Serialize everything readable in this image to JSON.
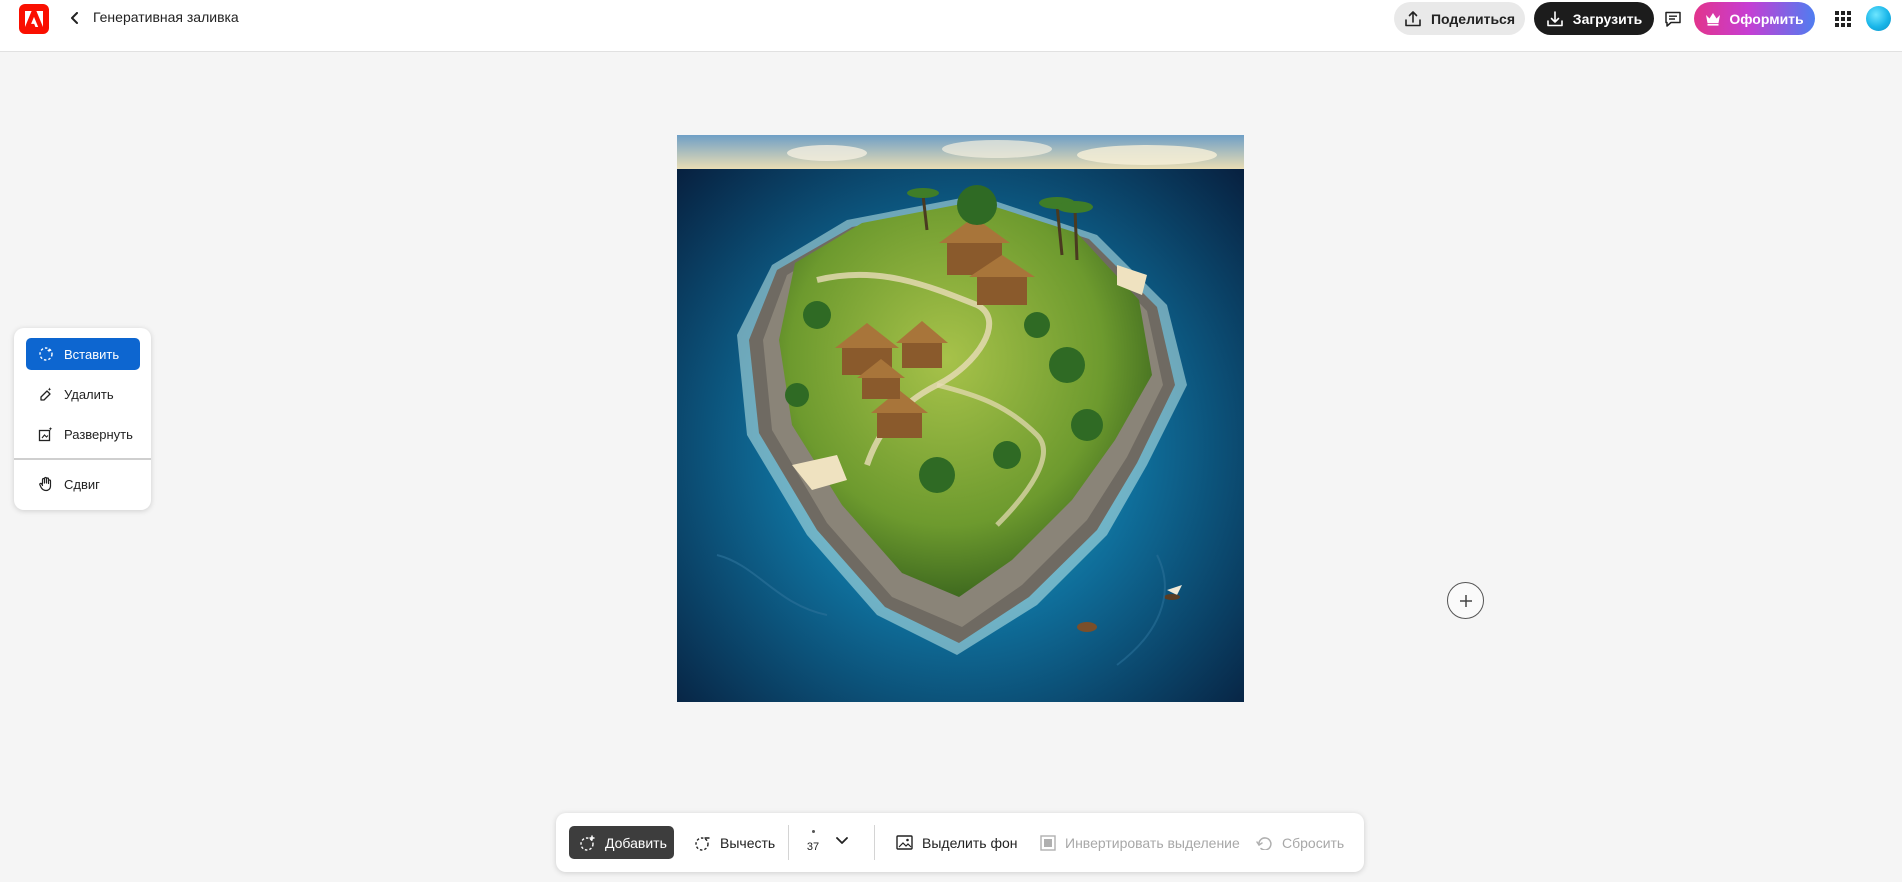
{
  "header": {
    "title": "Генеративная заливка",
    "share_label": "Поделиться",
    "download_label": "Загрузить",
    "premium_label": "Оформить",
    "logo_icon": "adobe-logo-icon",
    "accent_color": "#fa0f00"
  },
  "tools": {
    "items": [
      {
        "label": "Вставить",
        "icon": "insert-icon",
        "active": true
      },
      {
        "label": "Удалить",
        "icon": "remove-icon",
        "active": false
      },
      {
        "label": "Развернуть",
        "icon": "expand-icon",
        "active": false
      },
      {
        "label": "Сдвиг",
        "icon": "hand-icon",
        "active": false
      }
    ],
    "active_color": "#0d66d0"
  },
  "toolbar": {
    "add_label": "Добавить",
    "subtract_label": "Вычесть",
    "brush_size": "37",
    "select_bg_label": "Выделить фон",
    "invert_label": "Инвертировать выделение",
    "reset_label": "Сбросить"
  }
}
